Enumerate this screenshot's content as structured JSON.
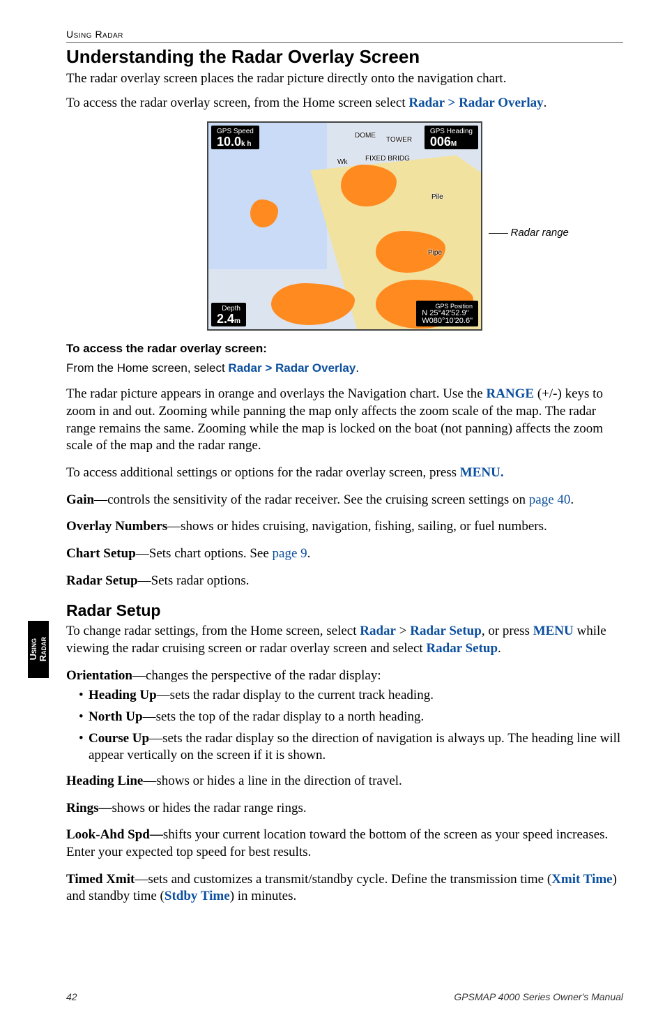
{
  "running_head": "Using Radar",
  "title1": "Understanding the Radar Overlay Screen",
  "p1": "The radar overlay screen places the radar picture directly onto the navigation chart.",
  "p2a": "To access the radar overlay screen, from the Home screen select ",
  "p2b": "Radar > Radar Overlay",
  "p2c": ".",
  "fig": {
    "tl_small": "GPS Speed",
    "tl_val": "10.0",
    "tl_unit": "k h",
    "tr_small": "GPS Heading",
    "tr_val": "006",
    "tr_unit": "M",
    "bl_small": "Depth",
    "bl_val": "2.4",
    "bl_unit": "m",
    "br_small": "GPS Position",
    "br_line1": "N  25°42'52.9\"",
    "br_line2": "W080°10'20.6\"",
    "label_tower": "TOWER",
    "label_bridge": "FIXED BRIDG",
    "label_dome": "DOME",
    "label_pile": "Pile",
    "label_pipe": "Pipe",
    "label_wk": "Wk",
    "caption": "Radar range"
  },
  "access_head": "To access the radar overlay screen:",
  "access_a": "From the Home screen, select ",
  "access_b": "Radar > Radar Overlay",
  "access_c": ".",
  "p3a": "The radar picture appears in orange and overlays the Navigation chart. Use the ",
  "p3b": "RANGE",
  "p3c": " (+/-) keys to zoom in and out. Zooming while panning the map only affects the zoom scale of the map. The radar range remains the same. Zooming while the map is locked on the boat (not panning) affects the zoom scale of the map and the radar range.",
  "p4a": "To access additional settings or options for the radar overlay screen, press ",
  "p4b": "MENU.",
  "gain_a": "Gain",
  "gain_b": "—controls the sensitivity of the radar receiver. See the cruising screen settings on ",
  "gain_c": "page 40",
  "gain_d": ".",
  "overlay_a": "Overlay Numbers",
  "overlay_b": "—shows or hides cruising, navigation, fishing, sailing, or fuel numbers.",
  "chart_a": "Chart Setup",
  "chart_b": "—Sets chart options. See ",
  "chart_c": "page 9",
  "chart_d": ".",
  "radarsetup_a": "Radar Setup",
  "radarsetup_b": "—Sets radar options.",
  "title2": "Radar Setup",
  "rs1a": "To change radar settings, from the Home screen, select ",
  "rs1b": "Radar",
  "rs1c": " > ",
  "rs1d": "Radar Setup",
  "rs1e": ", or press ",
  "rs1f": "MENU",
  "rs1g": " while viewing the radar cruising screen or radar overlay screen and select ",
  "rs1h": "Radar Setup",
  "rs1i": ".",
  "orient_a": "Orientation",
  "orient_b": "—changes the perspective of the radar display:",
  "li1a": "Heading Up",
  "li1b": "—sets the radar display to the current track heading.",
  "li2a": "North Up",
  "li2b": "—sets the top of the radar display to a north heading.",
  "li3a": "Course Up",
  "li3b": "—sets the radar display so the direction of navigation is always up. The heading line will appear vertically on the screen if it is shown.",
  "hl_a": "Heading Line",
  "hl_b": "—shows or hides a line in the direction of travel.",
  "rings_a": "Rings—",
  "rings_b": "shows or hides the radar range rings.",
  "look_a": "Look-Ahd Spd—",
  "look_b": "shifts your current location toward the bottom of the screen as your speed increases. Enter your expected top speed for best results.",
  "tx_a": "Timed Xmit",
  "tx_b": "—sets and customizes a transmit/standby cycle. Define the transmission time (",
  "tx_c": "Xmit Time",
  "tx_d": ") and standby time (",
  "tx_e": "Stdby Time",
  "tx_f": ") in minutes.",
  "side_tab_l1": "Using",
  "side_tab_l2": "Radar",
  "footer_page": "42",
  "footer_right": "GPSMAP 4000 Series Owner's Manual"
}
